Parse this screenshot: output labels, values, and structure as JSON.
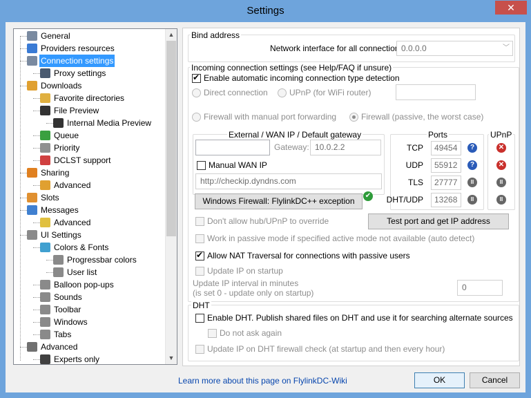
{
  "window": {
    "title": "Settings",
    "close_glyph": "✕"
  },
  "tree": {
    "items": [
      {
        "label": "General",
        "icon": "general-icon",
        "color": "#7a8aa0"
      },
      {
        "label": "Providers resources",
        "icon": "providers-icon",
        "color": "#3a7bd5"
      },
      {
        "label": "Connection settings",
        "icon": "connection-icon",
        "color": "#7a8aa0"
      },
      {
        "label": "Proxy settings",
        "icon": "proxy-icon",
        "color": "#4a5a70"
      },
      {
        "label": "Downloads",
        "icon": "downloads-icon",
        "color": "#e0a030"
      },
      {
        "label": "Favorite directories",
        "icon": "folder-icon",
        "color": "#e0b040"
      },
      {
        "label": "File Preview",
        "icon": "film-icon",
        "color": "#333333"
      },
      {
        "label": "Internal Media Preview",
        "icon": "film-icon",
        "color": "#333333"
      },
      {
        "label": "Queue",
        "icon": "queue-icon",
        "color": "#3aa040"
      },
      {
        "label": "Priority",
        "icon": "priority-icon",
        "color": "#909090"
      },
      {
        "label": "DCLST support",
        "icon": "dclst-icon",
        "color": "#d04040"
      },
      {
        "label": "Sharing",
        "icon": "sharing-icon",
        "color": "#e08020"
      },
      {
        "label": "Advanced",
        "icon": "advanced-icon",
        "color": "#e0a030"
      },
      {
        "label": "Slots",
        "icon": "slots-icon",
        "color": "#e09030"
      },
      {
        "label": "Messages",
        "icon": "messages-icon",
        "color": "#4080d0"
      },
      {
        "label": "Advanced",
        "icon": "advanced-icon",
        "color": "#e0c040"
      },
      {
        "label": "UI Settings",
        "icon": "ui-icon",
        "color": "#8a8a8a"
      },
      {
        "label": "Colors & Fonts",
        "icon": "colors-icon",
        "color": "#40a0d0"
      },
      {
        "label": "Progressbar colors",
        "icon": "progressbar-icon",
        "color": "#8a8a8a"
      },
      {
        "label": "User list",
        "icon": "userlist-icon",
        "color": "#8a8a8a"
      },
      {
        "label": "Balloon pop-ups",
        "icon": "balloon-icon",
        "color": "#8a8a8a"
      },
      {
        "label": "Sounds",
        "icon": "sounds-icon",
        "color": "#8a8a8a"
      },
      {
        "label": "Toolbar",
        "icon": "toolbar-icon",
        "color": "#8a8a8a"
      },
      {
        "label": "Windows",
        "icon": "windows-icon",
        "color": "#8a8a8a"
      },
      {
        "label": "Tabs",
        "icon": "tabs-icon",
        "color": "#8a8a8a"
      },
      {
        "label": "Advanced",
        "icon": "tools-icon",
        "color": "#707070"
      },
      {
        "label": "Experts only",
        "icon": "expert-icon",
        "color": "#404040"
      }
    ],
    "scroll_up": "▲",
    "scroll_down": "▼"
  },
  "bind": {
    "group_label": "Bind address",
    "field_label": "Network interface for all connections",
    "value": "0.0.0.0",
    "arrow": "﹀"
  },
  "incoming": {
    "group_label": "Incoming connection settings (see Help/FAQ if unsure)",
    "auto_detect": "Enable automatic incoming connection type detection",
    "direct": "Direct connection",
    "upnp": "UPnP (for WiFi router)",
    "firewall_manual": "Firewall with manual port forwarding",
    "firewall_passive": "Firewall (passive, the worst case)",
    "wan_label": "External / WAN IP / Default gateway",
    "gateway_label": "Gateway:",
    "gateway_value": "10.0.2.2",
    "manual_wan": "Manual WAN IP",
    "checkip_value": "http://checkip.dyndns.com",
    "firewall_button": "Windows Firewall: FlylinkDC++ exception",
    "ports_label": "Ports",
    "upnp_label": "UPnP",
    "ports": [
      {
        "name": "TCP",
        "value": "49454",
        "status": "?",
        "upnp": "✕"
      },
      {
        "name": "UDP",
        "value": "55912",
        "status": "?",
        "upnp": "✕"
      },
      {
        "name": "TLS",
        "value": "27777",
        "status": "II",
        "upnp": "II"
      },
      {
        "name": "DHT/UDP",
        "value": "13268",
        "status": "II",
        "upnp": "II"
      }
    ],
    "ok_glyph": "✔",
    "no_override": "Don't allow hub/UPnP to override",
    "test_button": "Test port and get IP address",
    "passive_mode": "Work in passive mode if specified active mode not available (auto detect)",
    "nat_traversal": "Allow NAT Traversal for connections with passive users",
    "update_ip": "Update IP on startup",
    "interval_label_1": "Update IP interval in minutes",
    "interval_label_2": "(is set 0 - update only on startup)",
    "interval_value": "0"
  },
  "dht": {
    "group_label": "DHT",
    "enable": "Enable DHT. Publish shared files on DHT and use it for searching alternate sources",
    "do_not_ask": "Do not ask again",
    "update_ip": "Update IP on DHT firewall check (at startup and then every hour)"
  },
  "footer": {
    "link": "Learn more about this page on FlylinkDC-Wiki",
    "ok": "OK",
    "cancel": "Cancel"
  }
}
